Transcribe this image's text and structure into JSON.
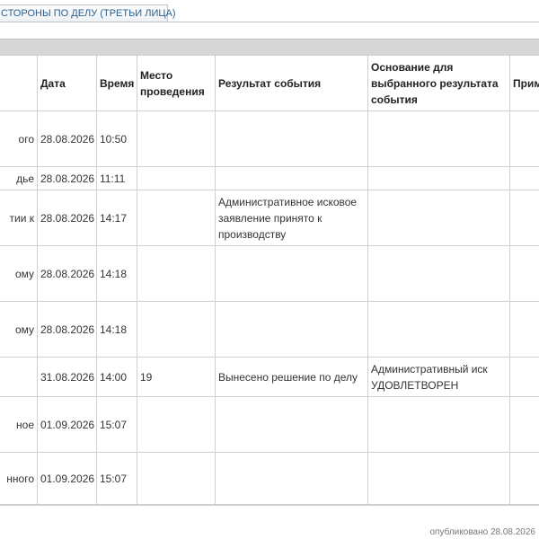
{
  "tab": {
    "label": "СТОРОНЫ ПО ДЕЛУ (ТРЕТЬИ ЛИЦА)"
  },
  "table": {
    "headers": {
      "name": "",
      "date": "Дата",
      "time": "Время",
      "place": "Место проведения",
      "result": "Результат события",
      "basis": "Основание для выбранного результата события",
      "note": "Прим"
    },
    "rows": [
      {
        "name": "ого",
        "date": "28.08.2026",
        "time": "10:50",
        "place": "",
        "result": "",
        "basis": "",
        "note": ""
      },
      {
        "name": "дье",
        "date": "28.08.2026",
        "time": "11:11",
        "place": "",
        "result": "",
        "basis": "",
        "note": ""
      },
      {
        "name": "тии к",
        "date": "28.08.2026",
        "time": "14:17",
        "place": "",
        "result": "Административное исковое заявление принято к производству",
        "basis": "",
        "note": ""
      },
      {
        "name": "ому",
        "date": "28.08.2026",
        "time": "14:18",
        "place": "",
        "result": "",
        "basis": "",
        "note": ""
      },
      {
        "name": "ому",
        "date": "28.08.2026",
        "time": "14:18",
        "place": "",
        "result": "",
        "basis": "",
        "note": ""
      },
      {
        "name": "",
        "date": "31.08.2026",
        "time": "14:00",
        "place": "19",
        "result": "Вынесено решение по делу",
        "basis": "Административный иск УДОВЛЕТВОРЕН",
        "note": ""
      },
      {
        "name": "ное",
        "date": "01.09.2026",
        "time": "15:07",
        "place": "",
        "result": "",
        "basis": "",
        "note": ""
      },
      {
        "name": "нного",
        "date": "01.09.2026",
        "time": "15:07",
        "place": "",
        "result": "",
        "basis": "",
        "note": ""
      }
    ]
  },
  "footer": {
    "published": "опубликовано 28.08.2026"
  }
}
